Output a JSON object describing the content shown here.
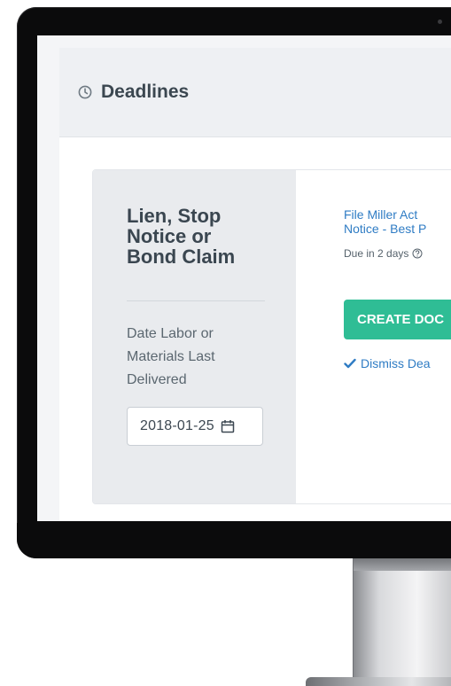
{
  "panel": {
    "title": "Deadlines",
    "icon": "clock-icon"
  },
  "card": {
    "heading_lines": [
      "Lien, Stop",
      "Notice or",
      "Bond Claim"
    ],
    "date_label_lines": [
      "Date Labor or",
      "Materials Last",
      "Delivered"
    ],
    "date_value": "2018-01-25",
    "task_link_lines": [
      "File Miller Act",
      "Notice - Best P"
    ],
    "due_text": "Due in 2 days",
    "create_button_label": "CREATE DOC",
    "dismiss_label": "Dismiss Dea"
  },
  "colors": {
    "accent_green": "#2fbd95",
    "link_blue": "#2f7cc4",
    "header_bg": "#eef0f3",
    "sidebar_bg": "#e9ebee",
    "bezel": "#0b0b0c"
  }
}
